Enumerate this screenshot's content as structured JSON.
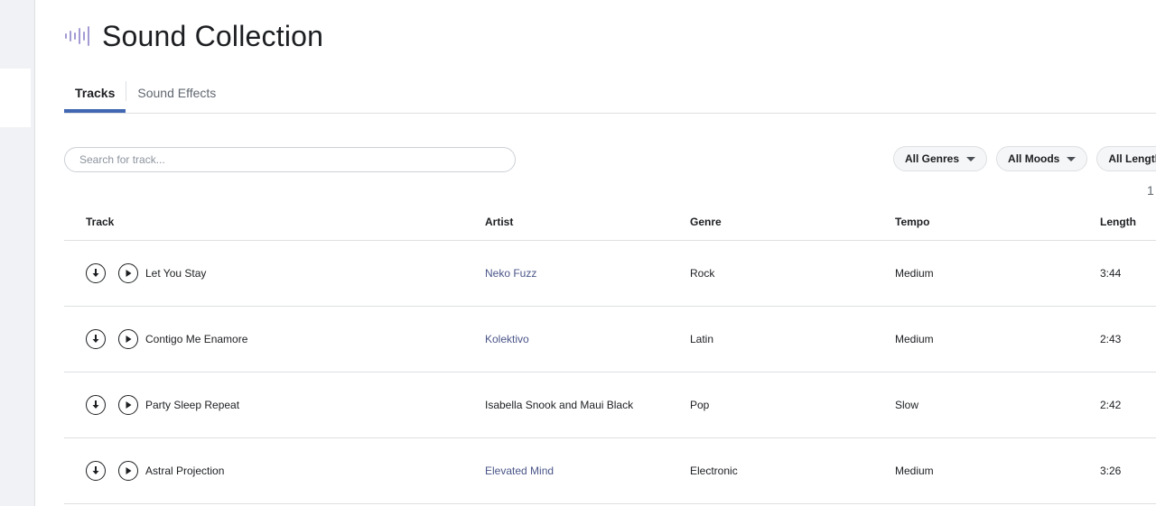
{
  "header": {
    "title": "Sound Collection",
    "logo_icon": "waveform-icon",
    "logo_color": "#a29bd4"
  },
  "tabs": [
    {
      "label": "Tracks",
      "active": true
    },
    {
      "label": "Sound Effects",
      "active": false
    }
  ],
  "search": {
    "placeholder": "Search for track...",
    "value": ""
  },
  "filters": [
    {
      "label": "All Genres"
    },
    {
      "label": "All Moods"
    },
    {
      "label": "All Lengths"
    }
  ],
  "pager": {
    "page": "1"
  },
  "table": {
    "columns": [
      "Track",
      "Artist",
      "Genre",
      "Tempo",
      "Length"
    ],
    "rows": [
      {
        "track": "Let You Stay",
        "artist": "Neko Fuzz",
        "artist_linked": true,
        "genre": "Rock",
        "tempo": "Medium",
        "length": "3:44"
      },
      {
        "track": "Contigo Me Enamore",
        "artist": "Kolektivo",
        "artist_linked": true,
        "genre": "Latin",
        "tempo": "Medium",
        "length": "2:43"
      },
      {
        "track": "Party Sleep Repeat",
        "artist": "Isabella Snook and Maui Black",
        "artist_linked": false,
        "genre": "Pop",
        "tempo": "Slow",
        "length": "2:42"
      },
      {
        "track": "Astral Projection",
        "artist": "Elevated Mind",
        "artist_linked": true,
        "genre": "Electronic",
        "tempo": "Medium",
        "length": "3:26"
      }
    ]
  },
  "colors": {
    "accent": "#4267b2",
    "artist_link": "#4a5588"
  }
}
